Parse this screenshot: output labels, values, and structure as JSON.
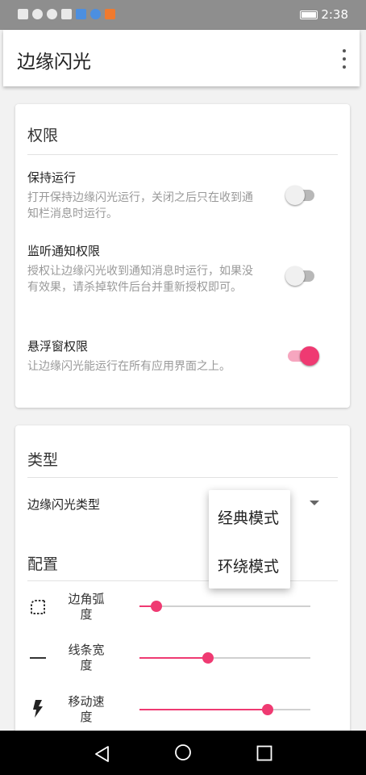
{
  "status_bar": {
    "time": "2:38"
  },
  "app_bar": {
    "title": "边缘闪光",
    "overflow_icon": "more-vert-icon"
  },
  "permissions": {
    "section_title": "权限",
    "items": [
      {
        "title": "保持运行",
        "description": "打开保持边缘闪光运行，关闭之后只在收到通知栏消息时运行。",
        "enabled": false
      },
      {
        "title": "监听通知权限",
        "description": "授权让边缘闪光收到通知消息时运行，如果没有效果，请杀掉软件后台并重新授权即可。",
        "enabled": false
      },
      {
        "title": "悬浮窗权限",
        "description": "让边缘闪光能运行在所有应用界面之上。",
        "enabled": true
      }
    ]
  },
  "type_section": {
    "section_title": "类型",
    "label": "边缘闪光类型"
  },
  "config": {
    "section_title": "配置",
    "sliders": [
      {
        "label_line1": "边角弧",
        "label_line2": "度",
        "icon": "rounded-corner-icon",
        "value_pct": 10
      },
      {
        "label_line1": "线条宽",
        "label_line2": "度",
        "icon": "line-width-icon",
        "value_pct": 40
      },
      {
        "label_line1": "移动速",
        "label_line2": "度",
        "icon": "lightning-bolt-icon",
        "value_pct": 75
      }
    ]
  },
  "dropdown_menu": {
    "options": [
      "经典模式",
      "环绕模式"
    ]
  },
  "colors": {
    "accent": "#ef3a72",
    "accent_light": "#f6a6bf",
    "status_bar": "#8e8e8e"
  }
}
